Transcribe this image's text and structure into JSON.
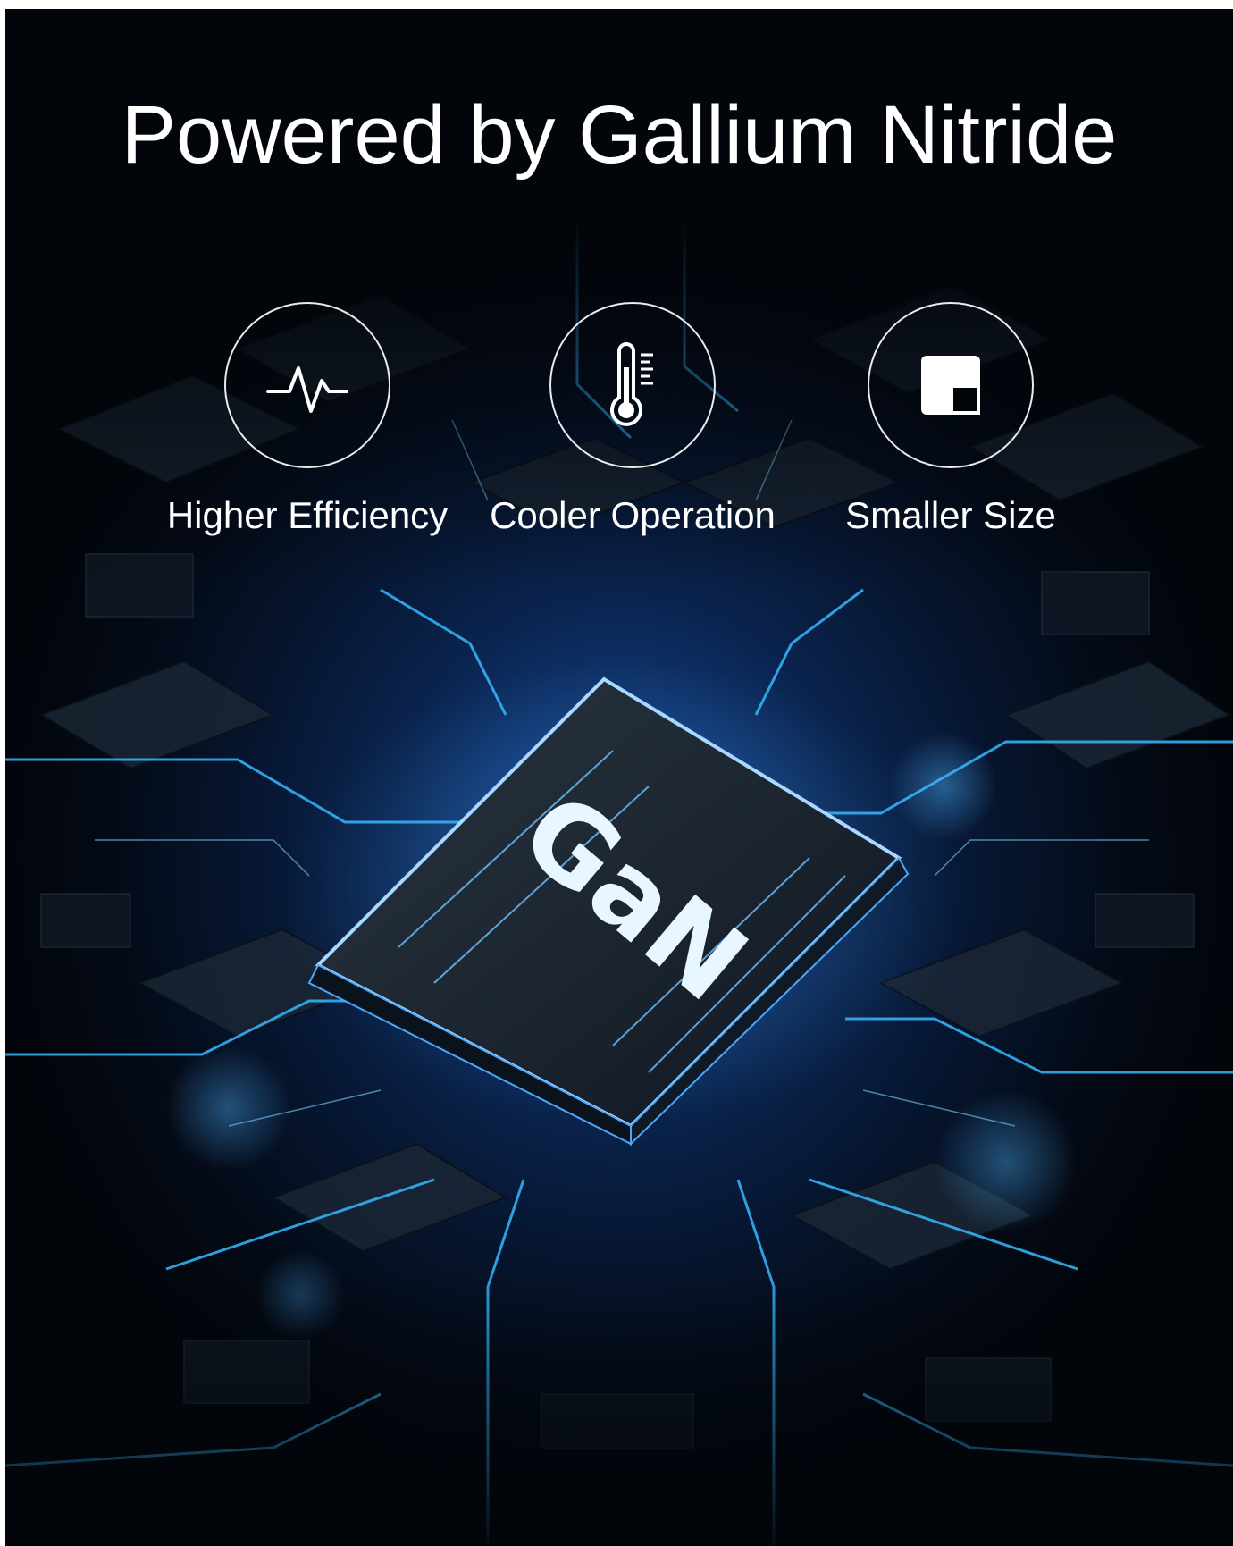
{
  "headline": "Powered by Gallium Nitride",
  "features": [
    {
      "label": "Higher Efficiency",
      "icon": "pulse-waveform-icon"
    },
    {
      "label": "Cooler Operation",
      "icon": "thermometer-icon"
    },
    {
      "label": "Smaller Size",
      "icon": "shrink-square-icon"
    }
  ],
  "chip_label": "GaN",
  "colors": {
    "background": "#02050a",
    "glow": "#2a8cff",
    "trace": "#35b8ff",
    "text": "#ffffff"
  }
}
